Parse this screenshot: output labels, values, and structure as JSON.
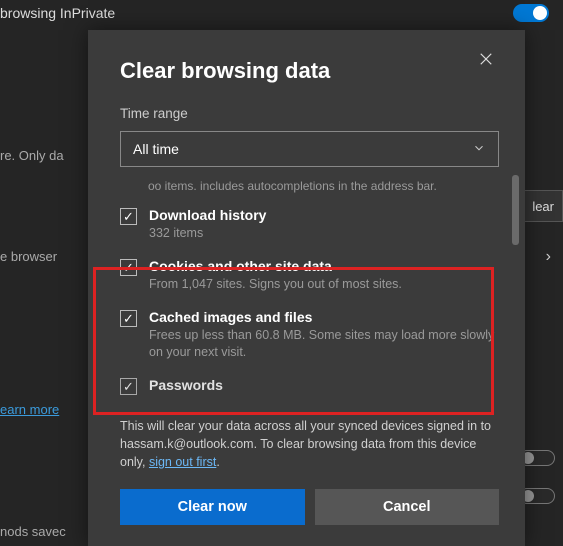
{
  "background": {
    "inprivate_label": "browsing InPrivate",
    "line_onlyda": "re. Only da",
    "line_browser": "e browser",
    "link_learn": "earn more",
    "line_savec": "nods savec",
    "bg_clear_btn": "lear"
  },
  "dialog": {
    "title": "Clear browsing data",
    "time_range_label": "Time range",
    "time_range_value": "All time",
    "truncated_top": "oo items. includes autocompletions in the address bar.",
    "items": [
      {
        "title": "Download history",
        "sub": "332 items",
        "checked": true
      },
      {
        "title": "Cookies and other site data",
        "sub": "From 1,047 sites. Signs you out of most sites.",
        "checked": true
      },
      {
        "title": "Cached images and files",
        "sub": "Frees up less than 60.8 MB. Some sites may load more slowly on your next visit.",
        "checked": true
      },
      {
        "title": "Passwords",
        "sub": "",
        "checked": true
      }
    ],
    "note_pre": "This will clear your data across all your synced devices signed in to hassam.k@outlook.com. To clear browsing data from this device only, ",
    "note_link": "sign out first",
    "note_post": ".",
    "clear_btn": "Clear now",
    "cancel_btn": "Cancel"
  }
}
